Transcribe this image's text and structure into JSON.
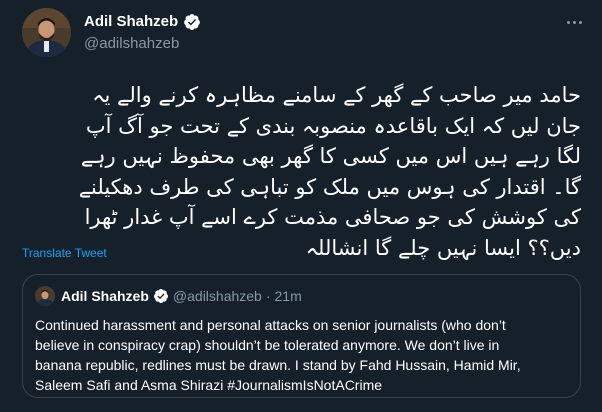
{
  "author": {
    "display_name": "Adil Shahzeb",
    "handle": "@adilshahzeb",
    "avatar_icon": "profile-photo"
  },
  "tweet": {
    "lines": [
      "حامد میر صاحب کے گھر کے سامنے مظاہرہ کرنے والے یہ",
      "جان لیں کہ ایک باقاعدہ منصوبہ بندی کے تحت جو آگ آپ",
      "لگا رہے ہیں اس میں کسی کا گھر بھی محفوظ نہیں رہے",
      "گا۔ اقتدار کی ہوس میں ملک کو تباہی کی طرف دھکیلنے",
      "کی کوشش کی جو صحافی مذمت کرے اسے آپ غدار ٹھرا",
      "دیں؟؟ ایسا نہیں چلے گا انشاللہ"
    ],
    "translate_label": "Translate Tweet"
  },
  "quote": {
    "display_name": "Adil Shahzeb",
    "handle": "@adilshahzeb",
    "separator": "·",
    "time": "21m",
    "lines": [
      "Continued harassment and personal attacks on senior journalists (who don’t",
      "believe in conspiracy crap) shouldn’t be tolerated anymore. We don’t live in",
      "banana republic, redlines must be drawn. I stand by Fahd Hussain, Hamid Mir,",
      "Saleem Safi and Asma Shirazi #JournalismIsNotACrime"
    ]
  },
  "colors": {
    "background": "#15202b",
    "primary_text": "#ffffff",
    "secondary_text": "#8899a6",
    "link": "#1da1f2",
    "border": "#38444d",
    "verified_badge": "#ffffff"
  }
}
